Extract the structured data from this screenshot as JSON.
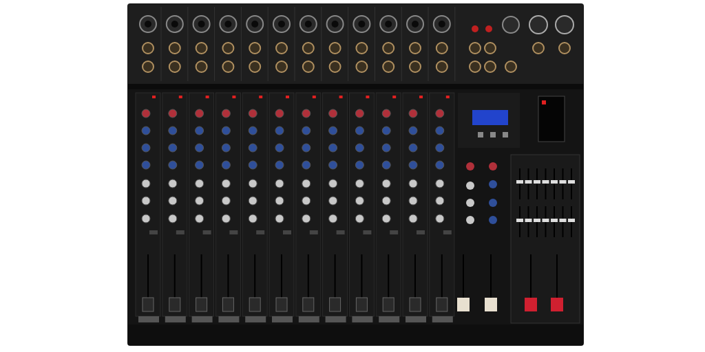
{
  "photo": {
    "kind": "audio-mixer"
  }
}
